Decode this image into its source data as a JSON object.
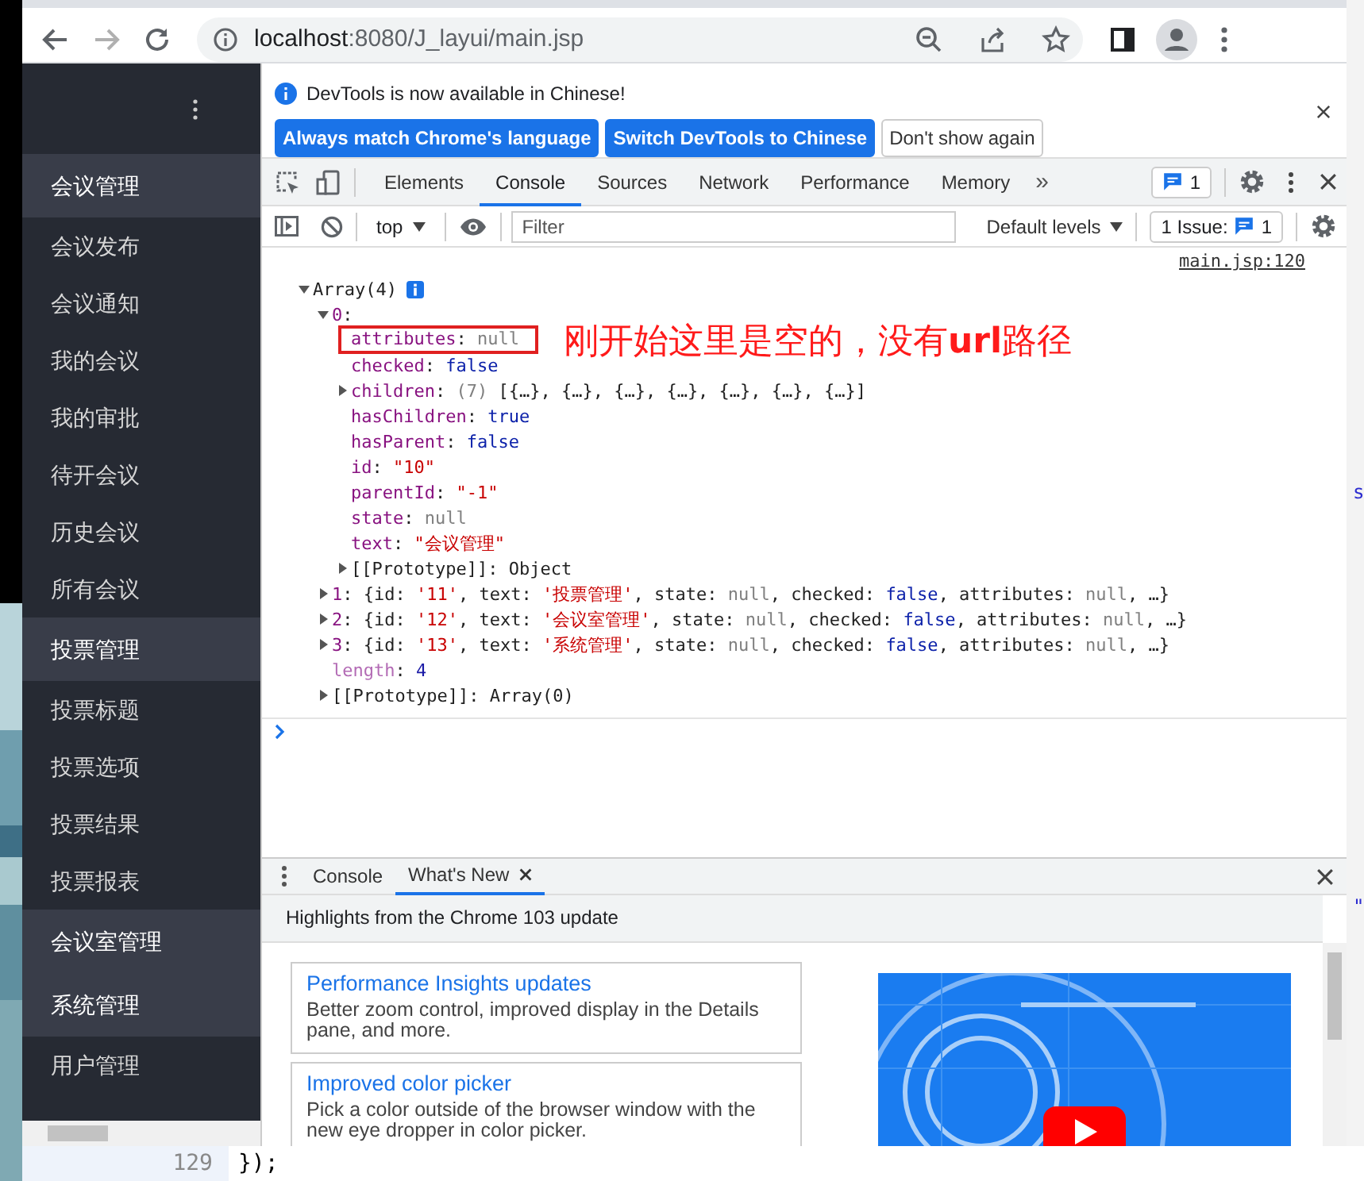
{
  "browser": {
    "forward": {
      "disabled": true
    },
    "address_bar": {
      "host": "localhost",
      "path": ":8080/J_layui/main.jsp"
    }
  },
  "sidebar": {
    "groups": [
      {
        "label": "会议管理",
        "items": [
          "会议发布",
          "会议通知",
          "我的会议",
          "我的审批",
          "待开会议",
          "历史会议",
          "所有会议"
        ]
      },
      {
        "label": "投票管理",
        "items": [
          "投票标题",
          "投票选项",
          "投票结果",
          "投票报表"
        ]
      },
      {
        "label": "会议室管理"
      },
      {
        "label": "系统管理",
        "items": [
          "用户管理"
        ]
      }
    ]
  },
  "devtools": {
    "infobar": {
      "message": "DevTools is now available in Chinese!",
      "buttons": [
        {
          "label": "Always match Chrome's language",
          "kind": "primary"
        },
        {
          "label": "Switch DevTools to Chinese",
          "kind": "primary"
        },
        {
          "label": "Don't show again",
          "kind": "secondary"
        }
      ]
    },
    "tabs": [
      {
        "label": "Elements",
        "selected": false
      },
      {
        "label": "Console",
        "selected": true
      },
      {
        "label": "Sources",
        "selected": false
      },
      {
        "label": "Network",
        "selected": false
      },
      {
        "label": "Performance",
        "selected": false
      },
      {
        "label": "Memory",
        "selected": false
      }
    ],
    "more_tabs": "»",
    "messages_count": "1",
    "console_toolbar": {
      "context": "top",
      "filter_placeholder": "Filter",
      "levels": "Default levels",
      "issues_label": "1 Issue:",
      "issues_count": "1"
    },
    "source_link": "main.jsp:120",
    "tree": [
      {
        "expanded": true,
        "info": true,
        "tokens": [
          {
            "kind": "p",
            "text": "Array(4)"
          }
        ],
        "children": [
          {
            "expanded": true,
            "tokens": [
              {
                "kind": "key",
                "text": "0"
              },
              {
                "kind": "p",
                "text": ":"
              }
            ],
            "children": [
              {
                "boxed": true,
                "tokens": [
                  {
                    "kind": "key",
                    "text": "attributes"
                  },
                  {
                    "kind": "p",
                    "text": ": "
                  },
                  {
                    "kind": "null",
                    "text": "null"
                  }
                ]
              },
              {
                "tokens": [
                  {
                    "kind": "key",
                    "text": "checked"
                  },
                  {
                    "kind": "p",
                    "text": ": "
                  },
                  {
                    "kind": "bool",
                    "text": "false"
                  }
                ]
              },
              {
                "expanded": false,
                "tokens": [
                  {
                    "kind": "key",
                    "text": "children"
                  },
                  {
                    "kind": "p",
                    "text": ": "
                  },
                  {
                    "kind": "dim",
                    "text": "(7)"
                  },
                  {
                    "kind": "p",
                    "text": " [{…}, {…}, {…}, {…}, {…}, {…}, {…}]"
                  }
                ]
              },
              {
                "tokens": [
                  {
                    "kind": "key",
                    "text": "hasChildren"
                  },
                  {
                    "kind": "p",
                    "text": ": "
                  },
                  {
                    "kind": "bool",
                    "text": "true"
                  }
                ]
              },
              {
                "tokens": [
                  {
                    "kind": "key",
                    "text": "hasParent"
                  },
                  {
                    "kind": "p",
                    "text": ": "
                  },
                  {
                    "kind": "bool",
                    "text": "false"
                  }
                ]
              },
              {
                "tokens": [
                  {
                    "kind": "key",
                    "text": "id"
                  },
                  {
                    "kind": "p",
                    "text": ": "
                  },
                  {
                    "kind": "str",
                    "text": "\"10\""
                  }
                ]
              },
              {
                "tokens": [
                  {
                    "kind": "key",
                    "text": "parentId"
                  },
                  {
                    "kind": "p",
                    "text": ": "
                  },
                  {
                    "kind": "str",
                    "text": "\"-1\""
                  }
                ]
              },
              {
                "tokens": [
                  {
                    "kind": "key",
                    "text": "state"
                  },
                  {
                    "kind": "p",
                    "text": ": "
                  },
                  {
                    "kind": "null",
                    "text": "null"
                  }
                ]
              },
              {
                "tokens": [
                  {
                    "kind": "key",
                    "text": "text"
                  },
                  {
                    "kind": "p",
                    "text": ": "
                  },
                  {
                    "kind": "str",
                    "text": "\"会议管理\""
                  }
                ]
              },
              {
                "expanded": false,
                "tokens": [
                  {
                    "kind": "p",
                    "text": "[[Prototype]]: Object"
                  }
                ]
              }
            ]
          },
          {
            "expanded": false,
            "tokens": [
              {
                "kind": "key",
                "text": "1"
              },
              {
                "kind": "p",
                "text": ": {id: "
              },
              {
                "kind": "str",
                "text": "'11'"
              },
              {
                "kind": "p",
                "text": ", text: "
              },
              {
                "kind": "str",
                "text": "'投票管理'"
              },
              {
                "kind": "p",
                "text": ", state: "
              },
              {
                "kind": "null",
                "text": "null"
              },
              {
                "kind": "p",
                "text": ", checked: "
              },
              {
                "kind": "bool",
                "text": "false"
              },
              {
                "kind": "p",
                "text": ", attributes: "
              },
              {
                "kind": "null",
                "text": "null"
              },
              {
                "kind": "p",
                "text": ", …}"
              }
            ]
          },
          {
            "expanded": false,
            "tokens": [
              {
                "kind": "key",
                "text": "2"
              },
              {
                "kind": "p",
                "text": ": {id: "
              },
              {
                "kind": "str",
                "text": "'12'"
              },
              {
                "kind": "p",
                "text": ", text: "
              },
              {
                "kind": "str",
                "text": "'会议室管理'"
              },
              {
                "kind": "p",
                "text": ", state: "
              },
              {
                "kind": "null",
                "text": "null"
              },
              {
                "kind": "p",
                "text": ", checked: "
              },
              {
                "kind": "bool",
                "text": "false"
              },
              {
                "kind": "p",
                "text": ", attributes: "
              },
              {
                "kind": "null",
                "text": "null"
              },
              {
                "kind": "p",
                "text": ", …}"
              }
            ]
          },
          {
            "expanded": false,
            "tokens": [
              {
                "kind": "key",
                "text": "3"
              },
              {
                "kind": "p",
                "text": ": {id: "
              },
              {
                "kind": "str",
                "text": "'13'"
              },
              {
                "kind": "p",
                "text": ", text: "
              },
              {
                "kind": "str",
                "text": "'系统管理'"
              },
              {
                "kind": "p",
                "text": ", state: "
              },
              {
                "kind": "null",
                "text": "null"
              },
              {
                "kind": "p",
                "text": ", checked: "
              },
              {
                "kind": "bool",
                "text": "false"
              },
              {
                "kind": "p",
                "text": ", attributes: "
              },
              {
                "kind": "null",
                "text": "null"
              },
              {
                "kind": "p",
                "text": ", …}"
              }
            ]
          },
          {
            "tokens": [
              {
                "kind": "keydim",
                "text": "length"
              },
              {
                "kind": "p",
                "text": ": "
              },
              {
                "kind": "num",
                "text": "4"
              }
            ]
          },
          {
            "expanded": false,
            "tokens": [
              {
                "kind": "p",
                "text": "[[Prototype]]: Array(0)"
              }
            ]
          }
        ]
      }
    ],
    "annotation": "刚开始这里是空的，没有**url**路径",
    "drawer": {
      "tabs": [
        {
          "label": "Console",
          "selected": false,
          "closable": false
        },
        {
          "label": "What's New",
          "selected": true,
          "closable": true
        }
      ],
      "headline": "Highlights from the Chrome 103 update",
      "cards": [
        {
          "title": "Performance Insights updates",
          "description": "Better zoom control, improved display in the Details pane, and more."
        },
        {
          "title": "Improved color picker",
          "description": "Pick a color outside of the browser window with the new eye dropper in color picker."
        }
      ]
    }
  },
  "background": {
    "line_number": "129",
    "code": "});",
    "fragments": [
      "s",
      "\""
    ]
  }
}
